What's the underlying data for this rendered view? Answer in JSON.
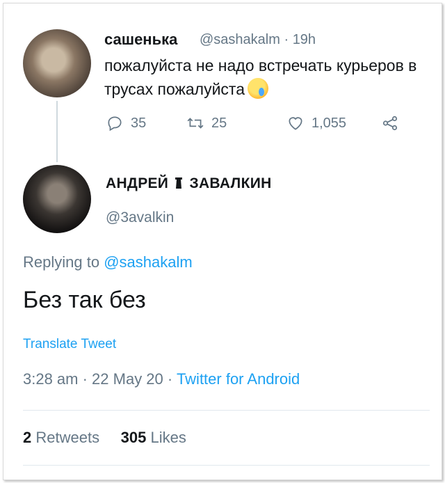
{
  "tweet1": {
    "display_name": "сашенька",
    "handle": "@sashakalm",
    "time": "19h",
    "text": "пожалуйста не надо встречать курьеров в трусах пожалуйста",
    "emoji_icon": "crying-face-icon",
    "actions": {
      "replies": "35",
      "retweets": "25",
      "likes": "1,055"
    }
  },
  "tweet2": {
    "display_name_part1": "АНДРЕЙ",
    "display_name_part2": "ЗАВАЛКИН",
    "name_icon": "tower-icon",
    "handle": "@3avalkin",
    "replying_to_label": "Replying to",
    "replying_to_handle": "@sashakalm",
    "text": "Без так без",
    "translate_label": "Translate Tweet",
    "timestamp": "3:28 am · 22 May 20 · ",
    "source": "Twitter for Android",
    "retweets_count": "2",
    "retweets_label": "Retweets",
    "likes_count": "305",
    "likes_label": "Likes"
  },
  "colors": {
    "link": "#1da1f2",
    "secondary_text": "#657786",
    "primary_text": "#14171a"
  }
}
